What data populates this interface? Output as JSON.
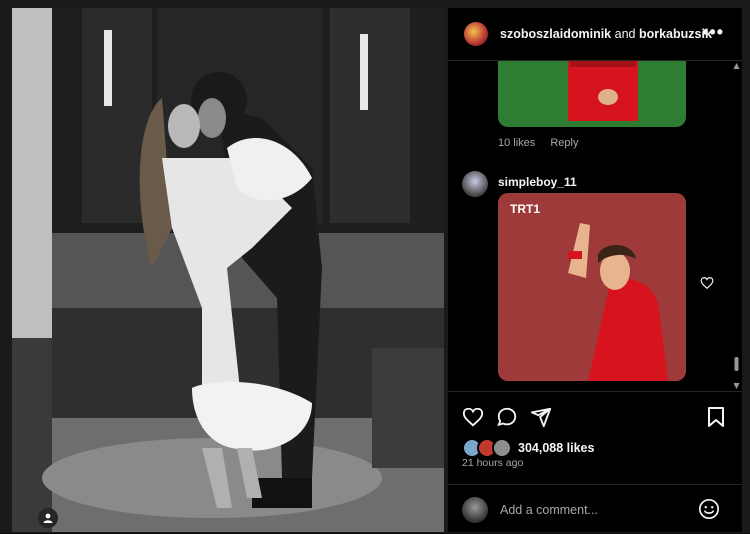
{
  "post": {
    "header": {
      "user1": "szoboszlaidominik",
      "conjunction": "and",
      "user2": "borkabuzsik",
      "more_icon": "more-horizontal-icon"
    },
    "comments": [
      {
        "likes_text": "10 likes",
        "reply_label": "Reply"
      },
      {
        "username": "simpleboy_11",
        "gif_overlay": "TRT1"
      }
    ],
    "likes_text": "304,088 likes",
    "time_ago": "21 hours ago",
    "comment_placeholder": "Add a comment..."
  },
  "colors": {
    "background": "#000000",
    "muted_text": "#a8a8a8",
    "divider": "#262626",
    "jersey_red": "#d7141e",
    "pitch_green": "#2f7d32"
  }
}
